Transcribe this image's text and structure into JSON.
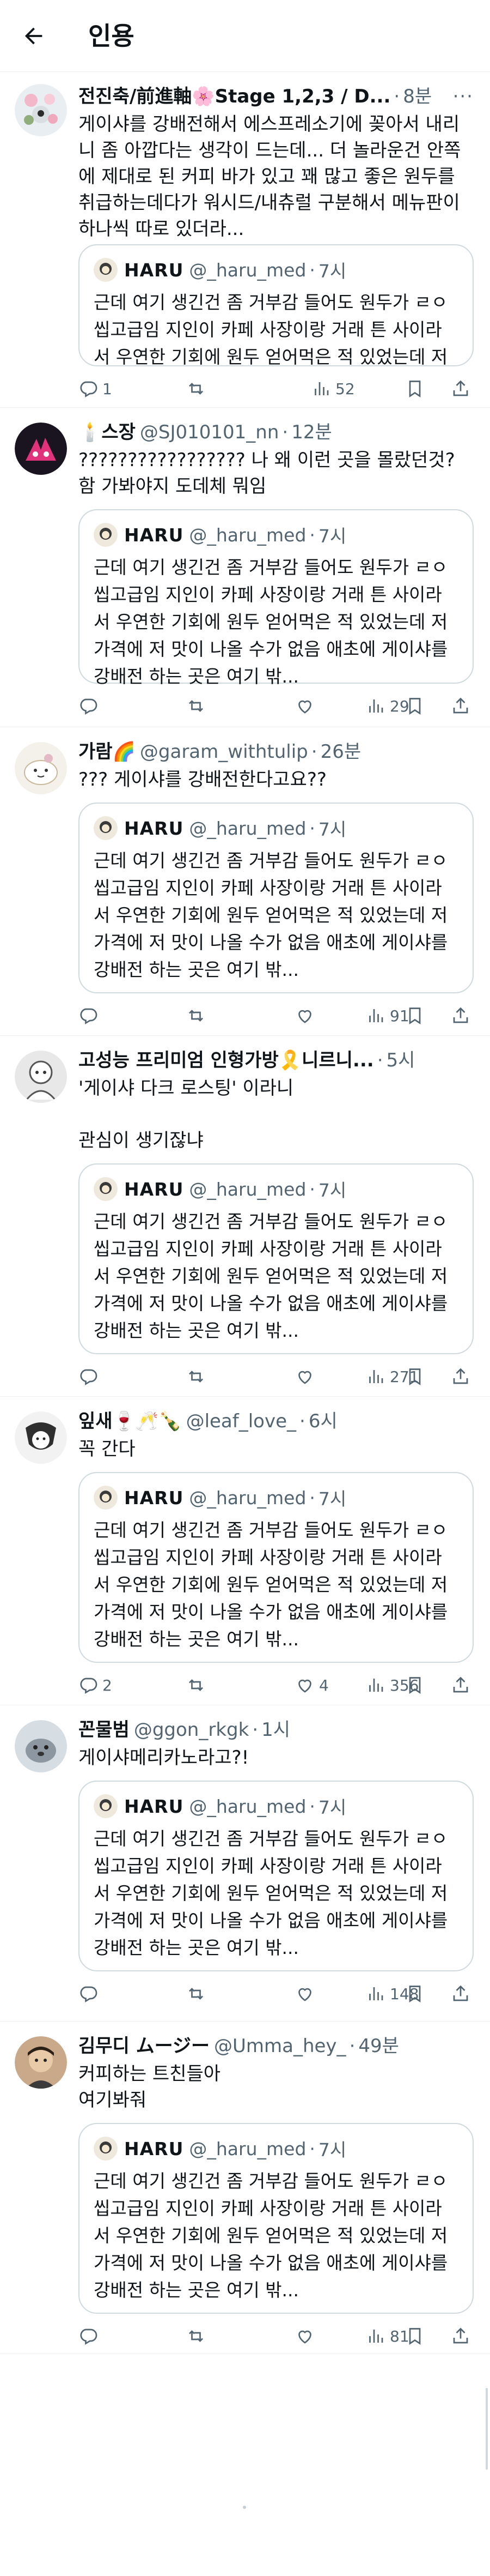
{
  "header": {
    "title": "인용",
    "back_icon": "arrow-left-icon"
  },
  "colors": {
    "text": "#0f1419",
    "secondary": "#536471",
    "border": "#cfd9de"
  },
  "quoted_tweet": {
    "name": "HARU",
    "handle": "@_haru_med",
    "time": "7시",
    "text": "근데 여기 생긴건 좀 거부감 들어도 원두가 ㄹㅇ 씹고급임 지인이 카페 사장이랑 거래 튼 사이라서 우연한 기회에 원두 얻어먹은 적 있었는데 저 가격에 저 맛이 나올 수가 없음 애초에 게이샤를 강배전 하는 곳은 여기 밖..."
  },
  "tweets": [
    {
      "name": "전진축/前進軸🌸Stage 1,2,3 / D...",
      "handle": "",
      "time": "8분",
      "text": "게이샤를 강배전해서 에스프레소기에 꽂아서 내리니 좀 아깝다는 생각이 드는데... 더 놀라운건 안쪽에 제대로 된 커피 바가 있고 꽤 많고 좋은 원두를 취급하는데다가 워시드/내츄럴 구분해서 메뉴판이 하나씩 따로 있더라...",
      "stats": {
        "replies": "1",
        "retweets": "",
        "likes": "",
        "views": "52"
      }
    },
    {
      "name": "🕯️스장",
      "handle": "@SJ010101_nn",
      "time": "12분",
      "text": "????????????????? 나 왜 이런 곳을 몰랐던것? 함 가봐야지 도데체 뭐임",
      "stats": {
        "replies": "",
        "retweets": "",
        "likes": "",
        "views": "29"
      }
    },
    {
      "name": "가람🌈",
      "handle": "@garam_withtulip",
      "time": "26분",
      "text": "??? 게이샤를 강배전한다고요??",
      "stats": {
        "replies": "",
        "retweets": "",
        "likes": "",
        "views": "91"
      }
    },
    {
      "name": "고성능 프리미엄 인형가방🎗️니르니...",
      "handle": "",
      "time": "5시",
      "text": "'게이샤 다크 로스팅' 이라니\n\n관심이 생기잖냐",
      "stats": {
        "replies": "",
        "retweets": "",
        "likes": "",
        "views": "271"
      }
    },
    {
      "name": "잎새🍷🥂🍾",
      "handle": "@leaf_love_",
      "time": "6시",
      "text": "꼭 간다",
      "stats": {
        "replies": "2",
        "retweets": "",
        "likes": "4",
        "views": "356"
      }
    },
    {
      "name": "꼰물범",
      "handle": "@ggon_rkgk",
      "time": "1시",
      "text": "게이샤메리카노라고?!",
      "stats": {
        "replies": "",
        "retweets": "",
        "likes": "",
        "views": "148"
      }
    },
    {
      "name": "김무디 ムージー",
      "handle": "@Umma_hey_",
      "time": "49분",
      "text": "커피하는 트친들아\n여기봐줘",
      "stats": {
        "replies": "",
        "retweets": "",
        "likes": "",
        "views": "81"
      }
    }
  ]
}
